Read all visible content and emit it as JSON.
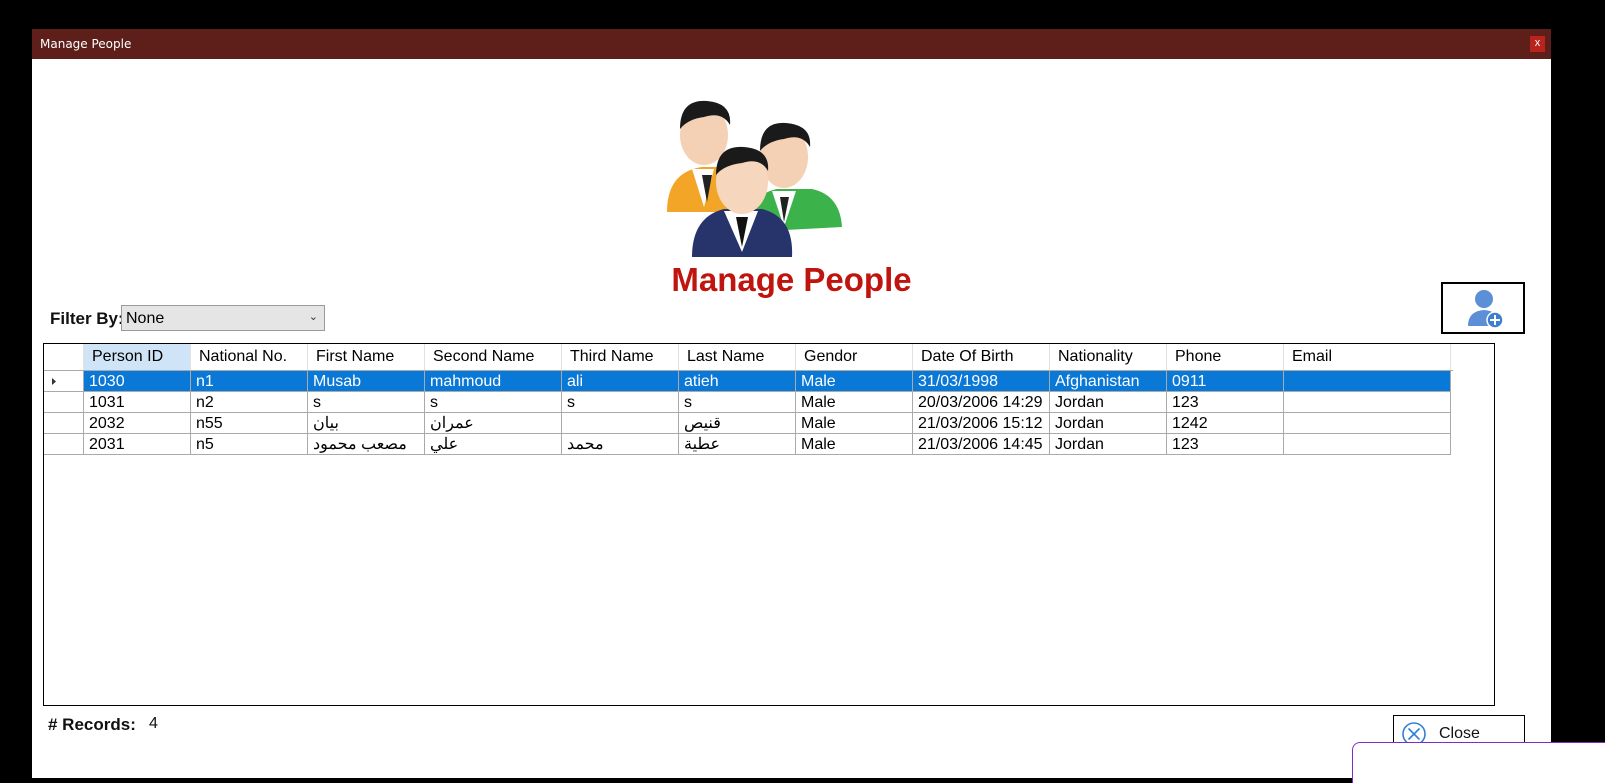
{
  "window": {
    "title": "Manage People",
    "close_glyph": "x"
  },
  "heading": "Manage People",
  "filter": {
    "label": "Filter By:",
    "value": "None"
  },
  "grid": {
    "columns": [
      "Person ID",
      "National No.",
      "First Name",
      "Second Name",
      "Third Name",
      "Last Name",
      "Gendor",
      "Date Of Birth",
      "Nationality",
      "Phone",
      "Email"
    ],
    "rows": [
      [
        "1030",
        "n1",
        "Musab",
        "mahmoud",
        "ali",
        "atieh",
        "Male",
        "31/03/1998",
        "Afghanistan",
        "0911",
        ""
      ],
      [
        "1031",
        "n2",
        "s",
        "s",
        "s",
        "s",
        "Male",
        "20/03/2006 14:29",
        "Jordan",
        "123",
        ""
      ],
      [
        "2032",
        "n55",
        "بيان",
        "عمران",
        "",
        "قنيص",
        "Male",
        "21/03/2006 15:12",
        "Jordan",
        "1242",
        ""
      ],
      [
        "2031",
        "n5",
        "مصعب محمود",
        "علي",
        "محمد",
        "عطية",
        "Male",
        "21/03/2006 14:45",
        "Jordan",
        "123",
        ""
      ]
    ],
    "selected_row": 0
  },
  "records": {
    "label": "# Records:",
    "count": "4"
  },
  "close_button": {
    "label": "Close"
  },
  "icons": {
    "hero": "people-group-icon",
    "add": "add-person-icon",
    "close": "close-circle-icon",
    "row_pointer": "row-pointer-icon",
    "dropdown": "chevron-down-icon"
  },
  "colors": {
    "titlebar": "#5e1f1a",
    "heading": "#c0140e",
    "selection": "#0a78d7",
    "active_header": "#cfe4f7"
  }
}
